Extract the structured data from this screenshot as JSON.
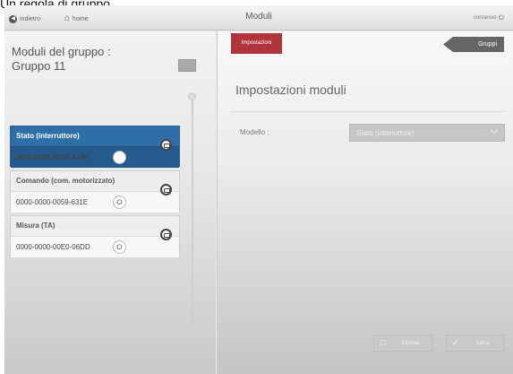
{
  "caption": "Un regola di gruppo",
  "topbar": {
    "back_label": "indietro",
    "home_label": "home",
    "title": "Moduli",
    "status_label": "connesso"
  },
  "tabs": {
    "impostazioni": "Impostazioni",
    "gruppi": "Gruppi"
  },
  "group": {
    "title": "Moduli del gruppo :\nGruppo 11"
  },
  "modules": [
    {
      "name": "Stato (interruttore)",
      "code": "0000-0000-001B-419E",
      "selected": true
    },
    {
      "name": "Comando (com. motorizzato)",
      "code": "0000-0000-0059-631E",
      "selected": false
    },
    {
      "name": "Misura (TA)",
      "code": "0000-0000-00E0-06DD",
      "selected": false
    }
  ],
  "settings": {
    "heading": "Impostazioni moduli",
    "model_label": "Modello :",
    "model_value": "Stato (interruttore)"
  },
  "actions": {
    "delete_label": "Elimina",
    "save_label": "Salva"
  },
  "colors": {
    "selected_module": "#2f6fa7",
    "active_tab": "#b0343b",
    "gruppi_tab": "#666666"
  }
}
